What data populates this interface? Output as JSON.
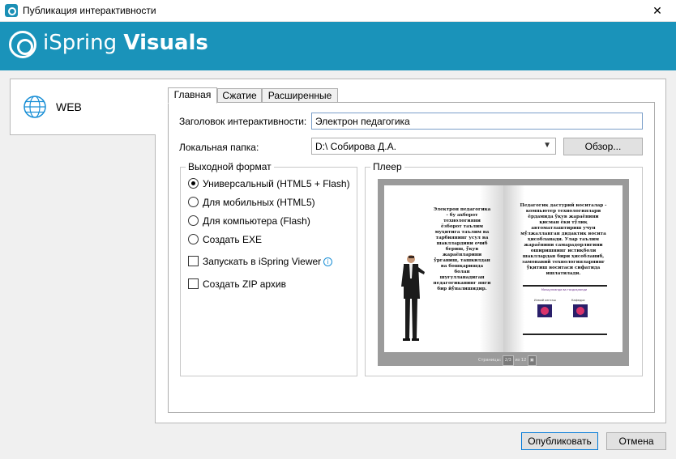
{
  "window": {
    "title": "Публикация интерактивности",
    "close_glyph": "✕"
  },
  "banner": {
    "brand_light": "iSpring ",
    "brand_bold": "Visuals"
  },
  "sidebar": {
    "items": [
      {
        "label": "WEB",
        "icon": "globe-icon"
      }
    ]
  },
  "tabs": [
    {
      "label": "Главная",
      "active": true
    },
    {
      "label": "Сжатие",
      "active": false
    },
    {
      "label": "Расширенные",
      "active": false
    }
  ],
  "form": {
    "title_label": "Заголовок интерактивности:",
    "title_value": "Электрон педагогика",
    "folder_label": "Локальная папка:",
    "folder_value": "D:\\ Собирова Д.А.",
    "browse_label": "Обзор..."
  },
  "output_format": {
    "title": "Выходной формат",
    "options": [
      {
        "label": "Универсальный (HTML5 + Flash)",
        "selected": true
      },
      {
        "label": "Для мобильных (HTML5)",
        "selected": false
      },
      {
        "label": "Для компьютера (Flash)",
        "selected": false
      },
      {
        "label": "Создать EXE",
        "selected": false
      }
    ],
    "checkboxes": [
      {
        "label": "Запускать в iSpring Viewer",
        "checked": false
      },
      {
        "label": "Создать ZIP архив",
        "checked": false
      }
    ]
  },
  "player": {
    "title": "Плеер",
    "left_page_text": "Электрон педагогика - бу ахборот технологияни ёзборот таълим муҳитига таълим ва тарбиянинг усул ва шакллардини очиб бериш, ўқув жараёнларини ўрганиш, ташкилдан ва бошқаришда болан шуғулланадиган педагогиканинг янги бир йўналишидир.",
    "right_page_text": "Педагогик дастурий воситалар - компьютер технологиялари ёрдамида ўқув жараёнини қисман ёки тўлиқ автоматлаштириш учун мўлжалланган дидактик восита ҳисобланади. Улар таълим жараёнини самарадорлигини оширишнинг истиқболи шакллардан бири ҳисобланиб, замонавий технологияларнинг ўқитиш воситаси сифатида ишлатилади.",
    "small_caption": "Маъқулланди ва тасдиқланди",
    "thumb_label_1": "Илмий кенгаш",
    "thumb_label_2": "Кафедра",
    "pages_label": "Страницы:",
    "pages_value": "2/3",
    "pages_of": "из 12"
  },
  "footer": {
    "publish_label": "Опубликовать",
    "cancel_label": "Отмена"
  },
  "colors": {
    "banner": "#1a93ba",
    "accent": "#0078d7"
  }
}
